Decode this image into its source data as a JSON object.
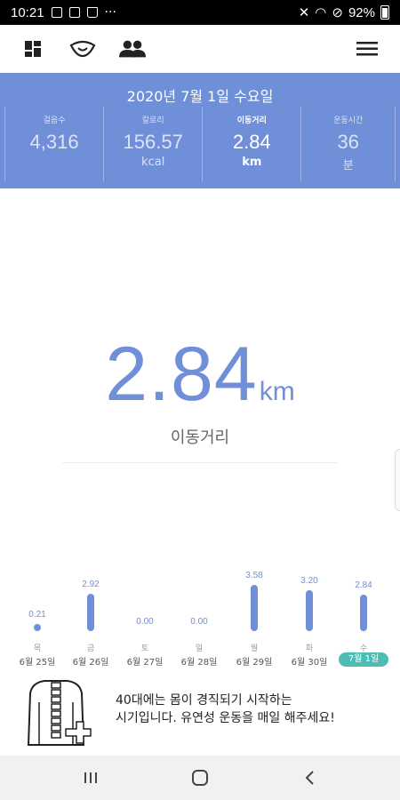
{
  "status": {
    "time": "10:21",
    "battery": "92%"
  },
  "nav": {
    "icons": [
      "dashboard-icon",
      "eye-icon",
      "people-icon",
      "menu-icon"
    ]
  },
  "summary": {
    "date": "2020년 7월 1일 수요일",
    "stats": [
      {
        "label": "걸음수",
        "value": "4,316",
        "unit": ""
      },
      {
        "label": "칼로리",
        "value": "156.57",
        "unit": "kcal"
      },
      {
        "label": "이동거리",
        "value": "2.84",
        "unit": "km"
      },
      {
        "label": "운동시간",
        "value": "36",
        "unit": "분"
      }
    ]
  },
  "main": {
    "value": "2.84",
    "unit": "km",
    "label": "이동거리"
  },
  "chart_data": {
    "type": "bar",
    "categories": [
      "6월 25일",
      "6월 26일",
      "6월 27일",
      "6월 28일",
      "6월 29일",
      "6월 30일",
      "7월 1일"
    ],
    "weekdays": [
      "목",
      "금",
      "토",
      "일",
      "월",
      "화",
      "수"
    ],
    "values": [
      0.21,
      2.92,
      0.0,
      0.0,
      3.58,
      3.2,
      2.84
    ],
    "value_labels": [
      "0.21",
      "2.92",
      "0.00",
      "0.00",
      "3.58",
      "3.20",
      "2.84"
    ],
    "highlight_index": 6,
    "ylim": [
      0,
      3.58
    ]
  },
  "tip": {
    "line1": "40대에는 몸이 경직되기 시작하는",
    "line2": "시기입니다. 유연성 운동을 매일 해주세요!"
  },
  "colors": {
    "primary": "#6f8fd9",
    "today_badge": "#4cbdb4"
  }
}
